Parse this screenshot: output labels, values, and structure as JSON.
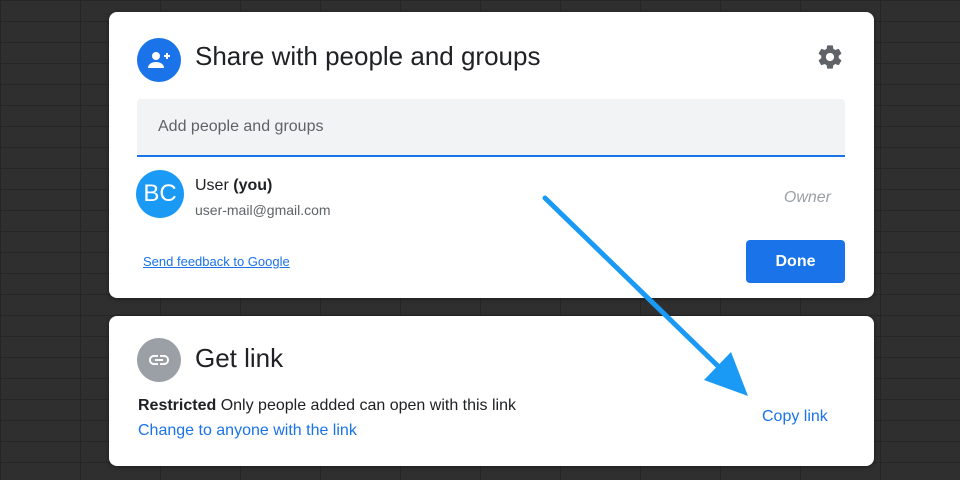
{
  "share_dialog": {
    "title": "Share with people and groups",
    "settings_icon": "gear-icon",
    "add_input_placeholder": "Add people and groups",
    "user": {
      "avatar_initials": "BC",
      "name": "User",
      "you_tag": "(you)",
      "email": "user-mail@gmail.com",
      "role": "Owner"
    },
    "feedback_link": "Send feedback to Google",
    "done_button": "Done"
  },
  "link_dialog": {
    "title": "Get link",
    "icon": "link-icon",
    "restricted_label": "Restricted",
    "restricted_desc": "Only people added can open with this link",
    "change_link": "Change to anyone with the link",
    "copy_link": "Copy link"
  },
  "colors": {
    "accent": "#1a73e8",
    "avatar_bg": "#1a9af5",
    "annotation_arrow": "#1a9af5",
    "background": "#2f2f2f"
  }
}
